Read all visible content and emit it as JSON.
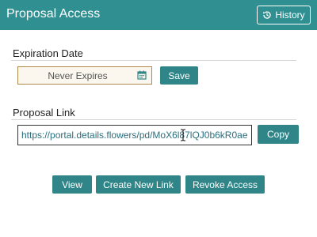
{
  "header": {
    "title": "Proposal Access",
    "history_label": "History"
  },
  "expiration": {
    "label": "Expiration Date",
    "value": "Never Expires",
    "save_label": "Save"
  },
  "link": {
    "label": "Proposal Link",
    "url": "https://portal.details.flowers/pd/MoX6l87lQJ0b6kR0ae",
    "copy_label": "Copy"
  },
  "actions": {
    "view": "View",
    "create": "Create New Link",
    "revoke": "Revoke Access"
  },
  "colors": {
    "header_bg": "#2f8f91",
    "button_bg": "#2f8587"
  }
}
